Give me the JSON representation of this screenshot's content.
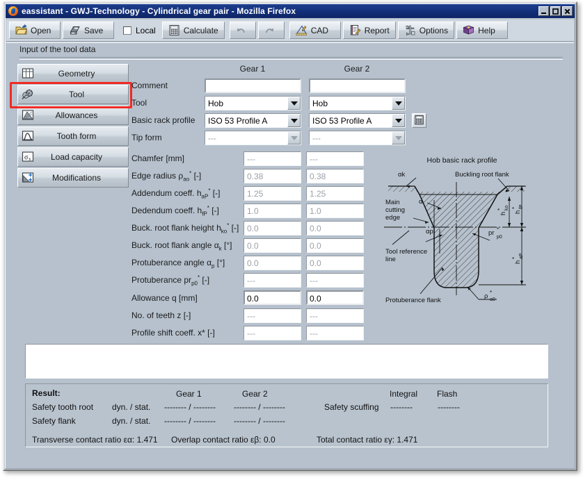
{
  "window": {
    "title": "eassistant - GWJ-Technology - Cylindrical gear pair - Mozilla Firefox",
    "controls": {
      "minimize": "_",
      "maximize": "□",
      "close": "X"
    }
  },
  "toolbar": {
    "open": "Open",
    "save": "Save",
    "local": "Local",
    "calculate": "Calculate",
    "undo": "",
    "redo": "",
    "cad": "CAD",
    "report": "Report",
    "options": "Options",
    "help": "Help"
  },
  "section": {
    "title": "Input of the tool data"
  },
  "sidebar": {
    "items": [
      {
        "label": "Geometry",
        "icon": "grid-icon"
      },
      {
        "label": "Tool",
        "icon": "gear-tool-icon"
      },
      {
        "label": "Allowances",
        "icon": "allowances-icon"
      },
      {
        "label": "Tooth form",
        "icon": "tooth-form-icon"
      },
      {
        "label": "Load capacity",
        "icon": "sigma-icon"
      },
      {
        "label": "Modifications",
        "icon": "modifications-icon"
      }
    ],
    "selected": "Tool"
  },
  "form": {
    "columns": [
      "Gear 1",
      "Gear 2"
    ],
    "rows": [
      {
        "label": "Comment",
        "kind": "text",
        "g1": "",
        "g2": "",
        "enabled": true
      },
      {
        "label": "Tool",
        "kind": "select",
        "g1": "Hob",
        "g2": "Hob",
        "enabled": true
      },
      {
        "label": "Basic rack profile",
        "kind": "select",
        "g1": "ISO 53 Profile A",
        "g2": "ISO 53 Profile A",
        "enabled": true
      },
      {
        "label": "Tip form",
        "kind": "select",
        "g1": "---",
        "g2": "---",
        "enabled": false
      },
      {
        "label": "Chamfer [mm]",
        "kind": "num",
        "g1": "---",
        "g2": "---",
        "enabled": false
      },
      {
        "label": "Edge radius ρao* [-]",
        "kind": "num",
        "g1": "0.38",
        "g2": "0.38",
        "enabled": false
      },
      {
        "label": "Addendum coeff. haP* [-]",
        "kind": "num",
        "g1": "1.25",
        "g2": "1.25",
        "enabled": false
      },
      {
        "label": "Dedendum coeff. hfP* [-]",
        "kind": "num",
        "g1": "1.0",
        "g2": "1.0",
        "enabled": false
      },
      {
        "label": "Buck. root flank height hko* [-]",
        "kind": "num",
        "g1": "0.0",
        "g2": "0.0",
        "enabled": false
      },
      {
        "label": "Buck. root flank angle αk [°]",
        "kind": "num",
        "g1": "0.0",
        "g2": "0.0",
        "enabled": false
      },
      {
        "label": "Protuberance angle αp [°]",
        "kind": "num",
        "g1": "0.0",
        "g2": "0.0",
        "enabled": false
      },
      {
        "label": "Protuberance prp0* [-]",
        "kind": "num",
        "g1": "---",
        "g2": "---",
        "enabled": false
      },
      {
        "label": "Allowance q [mm]",
        "kind": "num",
        "g1": "0.0",
        "g2": "0.0",
        "enabled": true
      },
      {
        "label": "No. of teeth z [-]",
        "kind": "num",
        "g1": "---",
        "g2": "---",
        "enabled": false
      },
      {
        "label": "Profile shift coeff. x* [-]",
        "kind": "num",
        "g1": "---",
        "g2": "---",
        "enabled": false
      }
    ],
    "calc_button_icon": "calculator-icon"
  },
  "diagram": {
    "title": "Hob basic rack profile",
    "labels": {
      "alpha_k": "αk",
      "buckling_root_flank": "Buckling root flank",
      "main_cutting_edge": "Main\ncutting\nedge",
      "main_cutting_edge_l1": "Main",
      "main_cutting_edge_l2": "cutting",
      "main_cutting_edge_l3": "edge",
      "alpha": "α",
      "alpha_p": "αp",
      "tool_reference_line_l1": "Tool reference",
      "tool_reference_line_l2": "line",
      "protuberance_flank": "Protuberance flank",
      "h_ko": "h*ko",
      "h_fp": "h*fP",
      "h_ap": "h*aP",
      "pr_p0": "pr*p0",
      "rho_a0": "ρ*a0"
    }
  },
  "result": {
    "heading": "Result:",
    "col_gear1": "Gear 1",
    "col_gear2": "Gear 2",
    "col_integral": "Integral",
    "col_flash": "Flash",
    "rows": [
      {
        "label": "Safety tooth root",
        "mode": "dyn. / stat.",
        "gear1": "-------- / --------",
        "gear2": "-------- / --------"
      },
      {
        "label": "Safety flank",
        "mode": "dyn. / stat.",
        "gear1": "-------- / --------",
        "gear2": "-------- / --------"
      }
    ],
    "scuffing_label": "Safety scuffing",
    "scuffing_integral": "--------",
    "scuffing_flash": "--------",
    "transverse_contact_ratio_label": "Transverse contact ratio εα:",
    "transverse_contact_ratio_value": "1.471",
    "overlap_contact_ratio_label": "Overlap contact ratio εβ:",
    "overlap_contact_ratio_value": "0.0",
    "total_contact_ratio_label": "Total contact ratio εγ:",
    "total_contact_ratio_value": "1.471"
  },
  "colors": {
    "titlebar": "#14307a",
    "panel": "#b6c1cd",
    "toolbar": "#cfd8e0",
    "highlight": "#ef2b24",
    "field_disabled_text": "#9aa1a8"
  }
}
